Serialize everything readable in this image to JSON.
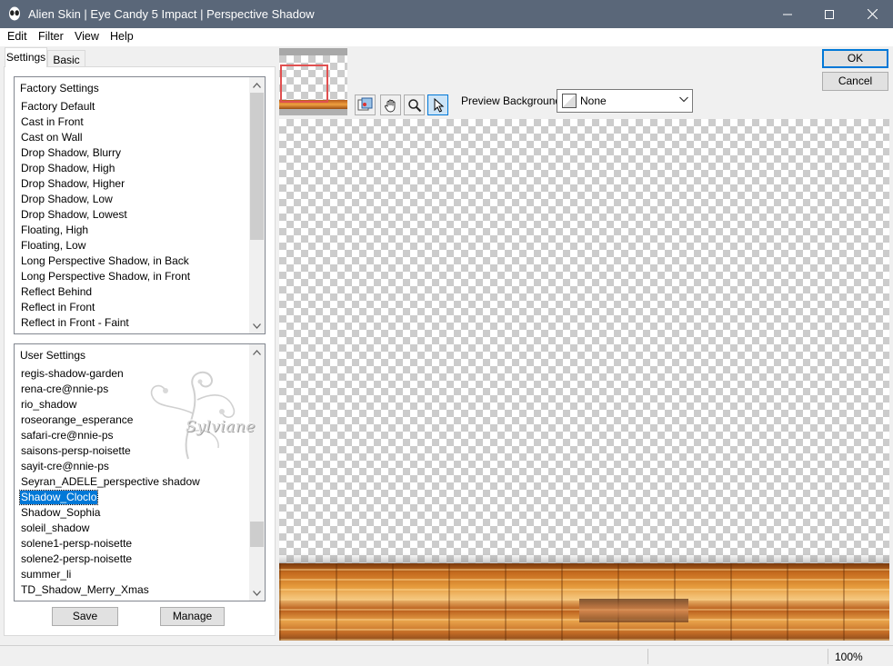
{
  "window": {
    "title": "Alien Skin | Eye Candy 5 Impact | Perspective Shadow",
    "app_icon": "alien-head-icon"
  },
  "menu": [
    "Edit",
    "Filter",
    "View",
    "Help"
  ],
  "tabs": [
    "Settings",
    "Basic"
  ],
  "factory_settings": {
    "header": "Factory Settings",
    "items": [
      "Factory Default",
      "Cast in Front",
      "Cast on Wall",
      "Drop Shadow, Blurry",
      "Drop Shadow, High",
      "Drop Shadow, Higher",
      "Drop Shadow, Low",
      "Drop Shadow, Lowest",
      "Floating, High",
      "Floating, Low",
      "Long Perspective Shadow, in Back",
      "Long Perspective Shadow, in Front",
      "Reflect Behind",
      "Reflect in Front",
      "Reflect in Front - Faint"
    ]
  },
  "user_settings": {
    "header": "User Settings",
    "items": [
      "regis-shadow-garden",
      "rena-cre@nnie-ps",
      "rio_shadow",
      "roseorange_esperance",
      "safari-cre@nnie-ps",
      "saisons-persp-noisette",
      "sayit-cre@nnie-ps",
      "Seyran_ADELE_perspective shadow",
      "Shadow_Cloclo",
      "Shadow_Sophia",
      "soleil_shadow",
      "solene1-persp-noisette",
      "solene2-persp-noisette",
      "summer_li",
      "TD_Shadow_Merry_Xmas"
    ],
    "selected": "Shadow_Cloclo"
  },
  "buttons": {
    "save": "Save",
    "manage": "Manage",
    "ok": "OK",
    "cancel": "Cancel"
  },
  "toolbar": {
    "tools": [
      "preview-toggle-icon",
      "hand-icon",
      "zoom-icon",
      "pointer-icon"
    ],
    "active_tool": "pointer-icon"
  },
  "preview_background": {
    "label": "Preview Background:",
    "value": "None"
  },
  "watermark": "Sylviane",
  "status": {
    "zoom": "100%"
  },
  "colors": {
    "titlebar": "#5a6779",
    "selection": "#0078d7",
    "navigator_frame": "#e05050"
  }
}
